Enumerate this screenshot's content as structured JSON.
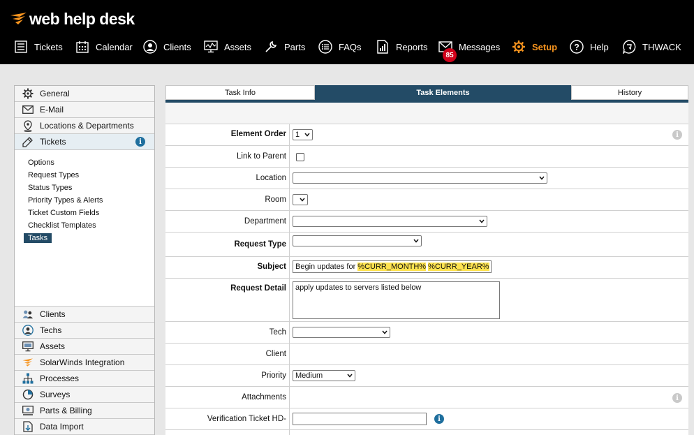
{
  "app": {
    "logo_text": "web help desk"
  },
  "nav": {
    "items": [
      {
        "label": "Tickets",
        "icon": "tickets-list-icon"
      },
      {
        "label": "Calendar",
        "icon": "calendar-icon"
      },
      {
        "label": "Clients",
        "icon": "clients-person-icon"
      },
      {
        "label": "Assets",
        "icon": "assets-monitor-icon"
      },
      {
        "label": "Parts",
        "icon": "parts-wrench-icon"
      },
      {
        "label": "FAQs",
        "icon": "faqs-list-icon"
      },
      {
        "label": "Reports",
        "icon": "reports-chart-icon"
      },
      {
        "label": "Messages",
        "icon": "messages-envelope-icon"
      },
      {
        "label": "Setup",
        "icon": "setup-gear-icon"
      },
      {
        "label": "Help",
        "icon": "help-question-icon"
      },
      {
        "label": "THWACK",
        "icon": "thwack-chat-icon"
      }
    ],
    "messages_badge": "85",
    "active_color": "#f7941e"
  },
  "sidebar": {
    "top_items": [
      {
        "label": "General",
        "icon": "gear-icon"
      },
      {
        "label": "E-Mail",
        "icon": "envelope-icon"
      },
      {
        "label": "Locations & Departments",
        "icon": "location-pin-icon"
      },
      {
        "label": "Tickets",
        "icon": "ticket-pencil-icon"
      }
    ],
    "tickets_info": "i",
    "sub_items": [
      "Options",
      "Request Types",
      "Status Types",
      "Priority Types & Alerts",
      "Ticket Custom Fields",
      "Checklist Templates",
      "Tasks"
    ],
    "bottom_items": [
      {
        "label": "Clients",
        "icon": "clients-group-icon"
      },
      {
        "label": "Techs",
        "icon": "techs-person-icon"
      },
      {
        "label": "Assets",
        "icon": "assets-monitor-icon"
      },
      {
        "label": "SolarWinds Integration",
        "icon": "solarwinds-icon"
      },
      {
        "label": "Processes",
        "icon": "processes-tree-icon"
      },
      {
        "label": "Surveys",
        "icon": "surveys-pie-icon"
      },
      {
        "label": "Parts & Billing",
        "icon": "parts-billing-icon"
      },
      {
        "label": "Data Import",
        "icon": "data-import-icon"
      }
    ]
  },
  "tabs": [
    {
      "label": "Task Info"
    },
    {
      "label": "Task Elements"
    },
    {
      "label": "History"
    }
  ],
  "form": {
    "element_order": {
      "label": "Element Order",
      "value": "1"
    },
    "link_to_parent": {
      "label": "Link to Parent"
    },
    "location": {
      "label": "Location",
      "value": ""
    },
    "room": {
      "label": "Room",
      "value": ""
    },
    "department": {
      "label": "Department",
      "value": ""
    },
    "request_type": {
      "label": "Request Type",
      "value": ""
    },
    "subject": {
      "label": "Subject",
      "prefix": "Begin updates for ",
      "token1": "%CURR_MONTH%",
      "token2": "%CURR_YEAR%"
    },
    "request_detail": {
      "label": "Request Detail",
      "value": "apply updates to servers listed below"
    },
    "tech": {
      "label": "Tech",
      "value": ""
    },
    "client": {
      "label": "Client"
    },
    "priority": {
      "label": "Priority",
      "value": "Medium"
    },
    "attachments": {
      "label": "Attachments"
    },
    "verification": {
      "label": "Verification Ticket HD-",
      "value": ""
    },
    "info_glyph": "i"
  }
}
